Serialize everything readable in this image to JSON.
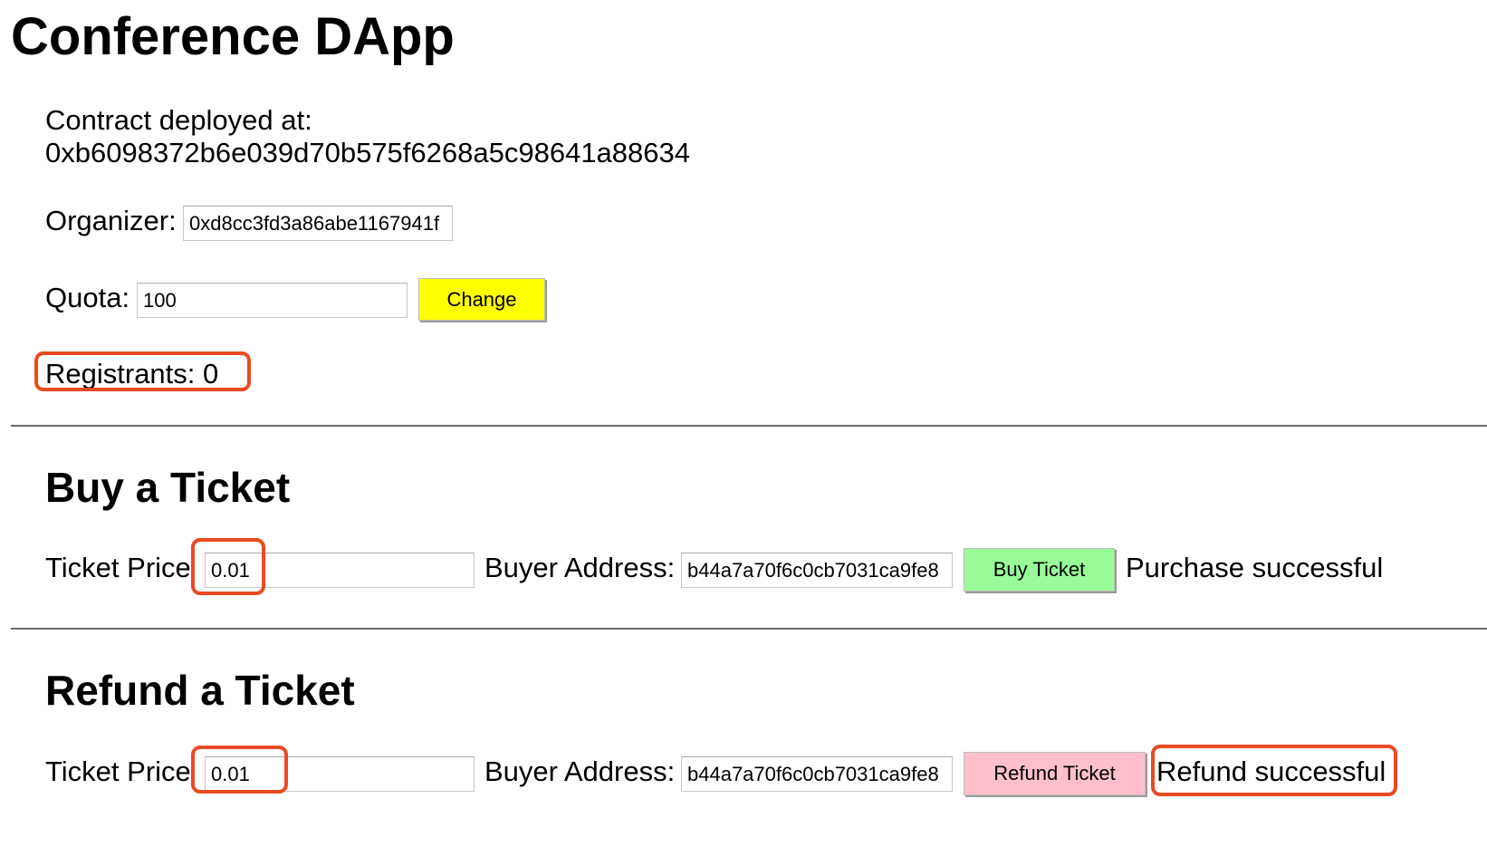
{
  "app": {
    "title": "Conference DApp"
  },
  "contract": {
    "label": "Contract deployed at:",
    "address": "0xb6098372b6e039d70b575f6268a5c98641a88634"
  },
  "organizer": {
    "label": "Organizer:",
    "value": "0xd8cc3fd3a86abe1167941f"
  },
  "quota": {
    "label": "Quota:",
    "value": "100",
    "change_button": "Change"
  },
  "registrants": {
    "text": "Registrants: 0"
  },
  "buy": {
    "title": "Buy a Ticket",
    "price_label": "Ticket Price",
    "price_value": "0.01",
    "buyer_label": "Buyer Address:",
    "buyer_value": "b44a7a70f6c0cb7031ca9fe8",
    "button": "Buy Ticket",
    "status": "Purchase successful"
  },
  "refund": {
    "title": "Refund a Ticket",
    "price_label": "Ticket Price",
    "price_value": "0.01",
    "buyer_label": "Buyer Address:",
    "buyer_value": "b44a7a70f6c0cb7031ca9fe8",
    "button": "Refund Ticket",
    "status": "Refund successful"
  },
  "colors": {
    "change_button": "#ffff00",
    "buy_button": "#98fb98",
    "refund_button": "#ffc0cb",
    "highlight": "#ea4a22",
    "divider": "#6c6c6c"
  }
}
